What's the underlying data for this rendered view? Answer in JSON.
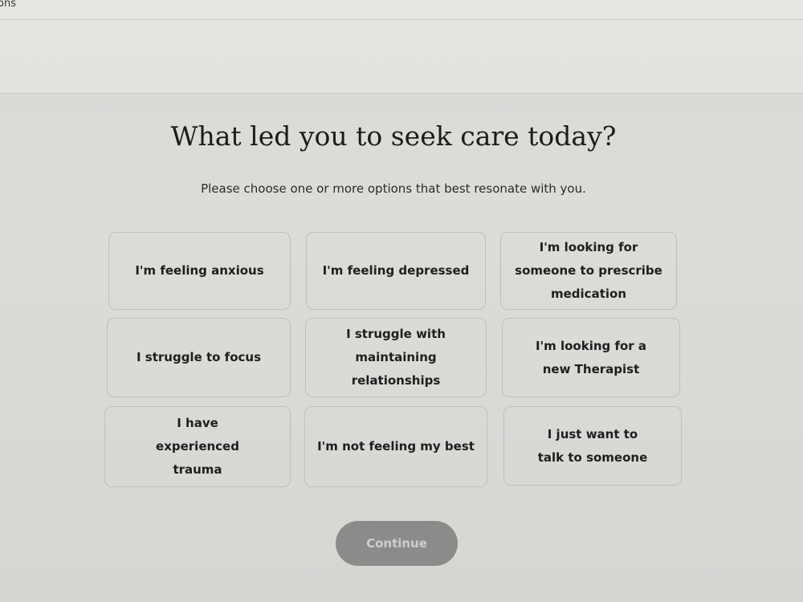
{
  "browser": {
    "tab_fragment": "ons"
  },
  "page": {
    "title": "What led you to seek care today?",
    "subtitle": "Please choose one or more options that best resonate with you."
  },
  "options": [
    {
      "label": "I'm feeling anxious"
    },
    {
      "label": "I'm feeling depressed"
    },
    {
      "label": "I'm looking for someone to prescribe medication"
    },
    {
      "label": "I struggle to focus"
    },
    {
      "label": "I struggle with maintaining relationships"
    },
    {
      "label": "I'm looking for a new Therapist"
    },
    {
      "label": "I have experienced trauma"
    },
    {
      "label": "I'm not feeling my best"
    },
    {
      "label": "I just want to talk to someone"
    }
  ],
  "actions": {
    "continue_label": "Continue"
  },
  "colors": {
    "background": "#d9d9d6",
    "option_border": "#bfbfbc",
    "continue_bg": "#8b8b8a",
    "continue_text": "#cfcfcf"
  }
}
